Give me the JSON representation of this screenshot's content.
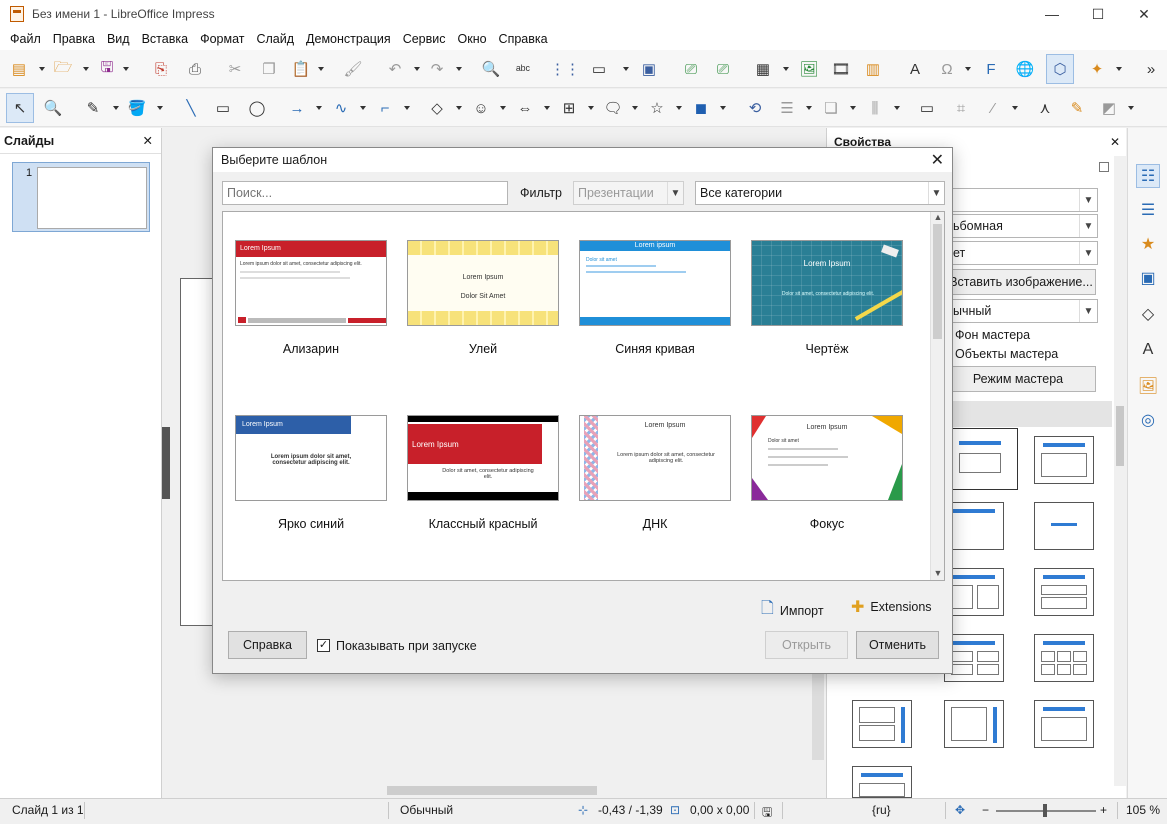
{
  "window": {
    "title": "Без имени 1 - LibreOffice Impress",
    "controls": [
      "—",
      "☐",
      "✕"
    ]
  },
  "menu": [
    "Файл",
    "Правка",
    "Вид",
    "Вставка",
    "Формат",
    "Слайд",
    "Демонстрация",
    "Сервис",
    "Окно",
    "Справка"
  ],
  "slides_pane": {
    "title": "Слайды",
    "close": "✕",
    "slide_number": "1"
  },
  "properties_pane": {
    "title": "Свойства",
    "close": "✕",
    "field_format": "ьбомная",
    "field_master": "ет",
    "insert_image": "Вставить изображение...",
    "field_background": "ычный",
    "master_background": "Фон мастера",
    "master_objects": "Объекты мастера",
    "master_mode": "Режим мастера"
  },
  "status": {
    "slide": "Слайд 1 из 1",
    "layout": "Обычный",
    "position": "-0,43 / -1,39",
    "size": "0,00 x 0,00",
    "language": "{ru}",
    "zoom": "105 %"
  },
  "dialog": {
    "title": "Выберите шаблон",
    "close": "✕",
    "search_placeholder": "Поиск...",
    "filter_label": "Фильтр",
    "filter_value": "Презентации",
    "category_value": "Все категории",
    "templates": [
      {
        "name": "Ализарин",
        "heading": "Lorem Ipsum",
        "sub": "Lorem ipsum dolor sit amet, consectetur adipiscing elit."
      },
      {
        "name": "Улей",
        "heading": "Lorem Ipsum",
        "sub": "Dolor Sit Amet"
      },
      {
        "name": "Синяя кривая",
        "heading": "Lorem ipsum",
        "sub": "Dolor sit amet"
      },
      {
        "name": "Чертёж",
        "heading": "Lorem Ipsum",
        "sub": "Dolor sit amet, consectetur adipiscing elit."
      },
      {
        "name": "Ярко синий",
        "heading": "Lorem Ipsum",
        "sub": "Lorem ipsum dolor sit amet, consectetur adipiscing elit."
      },
      {
        "name": "Классный красный",
        "heading": "Lorem Ipsum",
        "sub": "Dolor sit amet, consectetur adipiscing elit."
      },
      {
        "name": "ДНК",
        "heading": "Lorem Ipsum",
        "sub": "Lorem ipsum dolor sit amet, consectetur adipiscing elit."
      },
      {
        "name": "Фокус",
        "heading": "Lorem Ipsum",
        "sub": "Dolor sit amet"
      }
    ],
    "import_label": "Импорт",
    "extensions_label": "Extensions",
    "help_button": "Справка",
    "show_on_startup": "Показывать при запуске",
    "open_button": "Открыть",
    "cancel_button": "Отменить"
  },
  "colors": {
    "accent": "#2f7bd3",
    "alizarin_red": "#c8202a",
    "hive_yellow": "#f7e27a",
    "blue_curve": "#1f8fd8",
    "blueprint": "#2a7f95"
  }
}
